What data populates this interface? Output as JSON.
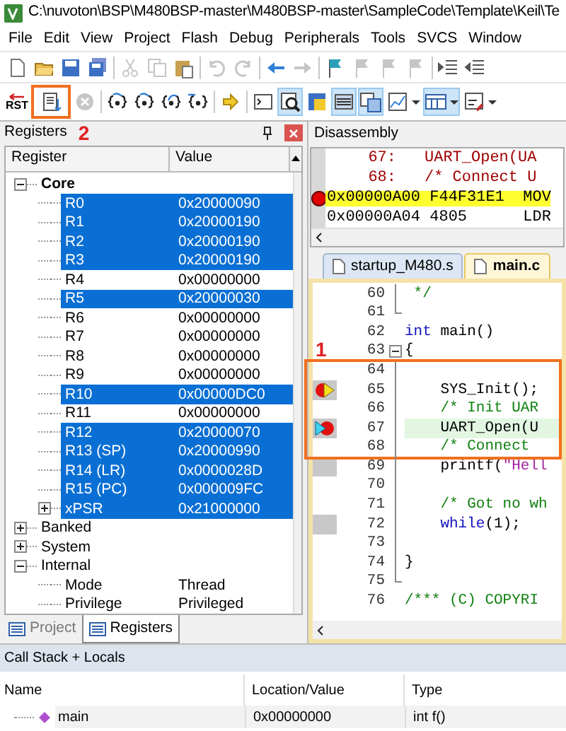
{
  "window": {
    "title": "C:\\nuvoton\\BSP\\M480BSP-master\\M480BSP-master\\SampleCode\\Template\\Keil\\Te"
  },
  "menu": [
    "File",
    "Edit",
    "View",
    "Project",
    "Flash",
    "Debug",
    "Peripherals",
    "Tools",
    "SVCS",
    "Window"
  ],
  "toolbar_1": [
    {
      "kind": "new",
      "disabled": false
    },
    {
      "kind": "open",
      "disabled": false
    },
    {
      "kind": "save",
      "disabled": false
    },
    {
      "kind": "save-all",
      "disabled": false
    },
    {
      "kind": "sep"
    },
    {
      "kind": "cut",
      "disabled": true
    },
    {
      "kind": "copy",
      "disabled": true
    },
    {
      "kind": "paste",
      "disabled": false
    },
    {
      "kind": "sep"
    },
    {
      "kind": "undo",
      "disabled": true
    },
    {
      "kind": "redo",
      "disabled": true
    },
    {
      "kind": "sep"
    },
    {
      "kind": "back",
      "disabled": false
    },
    {
      "kind": "forward",
      "disabled": true
    },
    {
      "kind": "sep"
    },
    {
      "kind": "bookmark",
      "disabled": false
    },
    {
      "kind": "bookmark",
      "disabled": true
    },
    {
      "kind": "bookmark",
      "disabled": true
    },
    {
      "kind": "bookmark",
      "disabled": true
    },
    {
      "kind": "sep"
    },
    {
      "kind": "indent",
      "disabled": false
    },
    {
      "kind": "unindent",
      "disabled": false
    }
  ],
  "toolbar_2": [
    {
      "kind": "reset",
      "label": "RST",
      "disabled": false,
      "pressed": false,
      "highlighted": false
    },
    {
      "kind": "run",
      "disabled": false,
      "pressed": false,
      "highlighted": true
    },
    {
      "kind": "stop",
      "disabled": true,
      "pressed": false,
      "highlighted": false
    },
    {
      "kind": "sep"
    },
    {
      "kind": "step-in",
      "disabled": false,
      "pressed": false,
      "highlighted": false
    },
    {
      "kind": "step-over",
      "disabled": false,
      "pressed": false,
      "highlighted": false
    },
    {
      "kind": "step-out",
      "disabled": false,
      "pressed": false,
      "highlighted": false
    },
    {
      "kind": "run-to-cursor",
      "disabled": false,
      "pressed": false,
      "highlighted": false
    },
    {
      "kind": "sep"
    },
    {
      "kind": "show-next",
      "disabled": false,
      "pressed": false,
      "highlighted": false
    },
    {
      "kind": "sep"
    },
    {
      "kind": "command",
      "disabled": false,
      "pressed": false,
      "highlighted": false
    },
    {
      "kind": "disassembly",
      "disabled": false,
      "pressed": true,
      "highlighted": false
    },
    {
      "kind": "symbols",
      "disabled": false,
      "pressed": false,
      "highlighted": false
    },
    {
      "kind": "registers",
      "disabled": false,
      "pressed": true,
      "highlighted": false
    },
    {
      "kind": "call-stack",
      "disabled": false,
      "pressed": true,
      "highlighted": false
    },
    {
      "kind": "watch",
      "disabled": false,
      "pressed": false,
      "highlighted": false,
      "dropdown": true
    },
    {
      "kind": "memory",
      "disabled": false,
      "pressed": true,
      "highlighted": false,
      "dropdown": true
    },
    {
      "kind": "serial",
      "disabled": false,
      "pressed": false,
      "highlighted": false,
      "dropdown": true
    }
  ],
  "registers_panel": {
    "title": "Registers",
    "callout": "2",
    "columns": [
      "Register",
      "Value"
    ],
    "rows": [
      {
        "name": "Core",
        "bold": true,
        "expanded": true,
        "selected": false,
        "children": [
          {
            "name": "R0",
            "value": "0x20000090",
            "selected": true
          },
          {
            "name": "R1",
            "value": "0x20000190",
            "selected": true
          },
          {
            "name": "R2",
            "value": "0x20000190",
            "selected": true
          },
          {
            "name": "R3",
            "value": "0x20000190",
            "selected": true
          },
          {
            "name": "R4",
            "value": "0x00000000",
            "selected": false
          },
          {
            "name": "R5",
            "value": "0x20000030",
            "selected": true
          },
          {
            "name": "R6",
            "value": "0x00000000",
            "selected": false
          },
          {
            "name": "R7",
            "value": "0x00000000",
            "selected": false
          },
          {
            "name": "R8",
            "value": "0x00000000",
            "selected": false
          },
          {
            "name": "R9",
            "value": "0x00000000",
            "selected": false
          },
          {
            "name": "R10",
            "value": "0x00000DC0",
            "selected": true
          },
          {
            "name": "R11",
            "value": "0x00000000",
            "selected": false
          },
          {
            "name": "R12",
            "value": "0x20000070",
            "selected": true
          },
          {
            "name": "R13 (SP)",
            "value": "0x20000990",
            "selected": true
          },
          {
            "name": "R14 (LR)",
            "value": "0x0000028D",
            "selected": true
          },
          {
            "name": "R15 (PC)",
            "value": "0x000009FC",
            "selected": true
          },
          {
            "name": "xPSR",
            "value": "0x21000000",
            "selected": true,
            "expanded": false
          }
        ]
      },
      {
        "name": "Banked",
        "expanded": false,
        "selected": false
      },
      {
        "name": "System",
        "expanded": false,
        "selected": false
      },
      {
        "name": "Internal",
        "expanded": true,
        "selected": false,
        "children": [
          {
            "name": "Mode",
            "value": "Thread",
            "selected": false
          },
          {
            "name": "Privilege",
            "value": "Privileged",
            "selected": false
          }
        ]
      }
    ]
  },
  "left_tabs": [
    {
      "label": "Project",
      "selected": false
    },
    {
      "label": "Registers",
      "selected": true
    }
  ],
  "disassembly": {
    "title": "Disassembly",
    "lines": [
      {
        "kind": "source",
        "number": "67:",
        "text": "UART_Open(UA"
      },
      {
        "kind": "source",
        "number": "68:",
        "text": "/* Connect U"
      },
      {
        "kind": "asm",
        "address": "0x00000A00",
        "opcode": "F44F31E1",
        "mnemonic": "MOV",
        "current": true,
        "breakpoint": true
      },
      {
        "kind": "asm",
        "address": "0x00000A04",
        "opcode": "4805",
        "mnemonic": "LDR",
        "current": false,
        "breakpoint": false
      }
    ]
  },
  "file_tabs": [
    {
      "label": "startup_M480.s",
      "selected": false
    },
    {
      "label": "main.c",
      "selected": true
    }
  ],
  "editor": {
    "callout": "1",
    "lines": [
      {
        "number": "60",
        "fold": {
          "kind": "line"
        },
        "executable": false,
        "highlighted": false,
        "boxed": false,
        "tokens": [
          {
            "kind": "comment",
            "text": " */"
          }
        ]
      },
      {
        "number": "61",
        "fold": {
          "kind": "end"
        },
        "executable": false,
        "highlighted": false,
        "boxed": false
      },
      {
        "number": "62",
        "executable": false,
        "highlighted": false,
        "boxed": false,
        "tokens": [
          {
            "kind": "keyword",
            "text": "int"
          },
          {
            "kind": "plain",
            "text": " main()"
          }
        ]
      },
      {
        "number": "63",
        "fold": {
          "kind": "box"
        },
        "executable": false,
        "highlighted": false,
        "boxed": false,
        "tokens": [
          {
            "kind": "plain",
            "text": "{"
          }
        ]
      },
      {
        "number": "64",
        "fold": {
          "kind": "line"
        },
        "executable": false,
        "highlighted": false,
        "boxed": true
      },
      {
        "number": "65",
        "fold": {
          "kind": "line"
        },
        "marker": {
          "kind": "current"
        },
        "executable": true,
        "highlighted": false,
        "boxed": true,
        "tokens": [
          {
            "kind": "plain",
            "text": "    SYS_Init();"
          }
        ]
      },
      {
        "number": "66",
        "fold": {
          "kind": "line"
        },
        "executable": false,
        "highlighted": false,
        "boxed": true,
        "tokens": [
          {
            "kind": "comment",
            "text": "    /* Init UAR"
          }
        ]
      },
      {
        "number": "67",
        "fold": {
          "kind": "line"
        },
        "marker": {
          "kind": "caller"
        },
        "executable": true,
        "highlighted": true,
        "boxed": true,
        "tokens": [
          {
            "kind": "plain",
            "text": "    UART_Open(U"
          }
        ]
      },
      {
        "number": "68",
        "fold": {
          "kind": "line"
        },
        "executable": false,
        "highlighted": false,
        "boxed": true,
        "tokens": [
          {
            "kind": "comment",
            "text": "    /* Connect"
          }
        ]
      },
      {
        "number": "69",
        "fold": {
          "kind": "line"
        },
        "executable": true,
        "highlighted": false,
        "boxed": false,
        "tokens": [
          {
            "kind": "plain",
            "text": "    printf("
          },
          {
            "kind": "string",
            "text": "\"Hell"
          }
        ]
      },
      {
        "number": "70",
        "fold": {
          "kind": "line"
        },
        "executable": false,
        "highlighted": false,
        "boxed": false
      },
      {
        "number": "71",
        "fold": {
          "kind": "line"
        },
        "executable": false,
        "highlighted": false,
        "boxed": false,
        "tokens": [
          {
            "kind": "comment",
            "text": "    /* Got no wh"
          }
        ]
      },
      {
        "number": "72",
        "fold": {
          "kind": "line"
        },
        "executable": true,
        "highlighted": false,
        "boxed": false,
        "tokens": [
          {
            "kind": "keyword",
            "text": "    while"
          },
          {
            "kind": "plain",
            "text": "(1);"
          }
        ]
      },
      {
        "number": "73",
        "fold": {
          "kind": "line"
        },
        "executable": false,
        "highlighted": false,
        "boxed": false
      },
      {
        "number": "74",
        "fold": {
          "kind": "line"
        },
        "executable": false,
        "highlighted": false,
        "boxed": false,
        "tokens": [
          {
            "kind": "plain",
            "text": "}"
          }
        ]
      },
      {
        "number": "75",
        "fold": {
          "kind": "end"
        },
        "executable": false,
        "highlighted": false,
        "boxed": false
      },
      {
        "number": "76",
        "executable": false,
        "highlighted": false,
        "boxed": false,
        "tokens": [
          {
            "kind": "comment",
            "text": "/*** (C) COPYRI"
          }
        ]
      }
    ]
  },
  "call_stack": {
    "title": "Call Stack + Locals",
    "columns": [
      "Name",
      "Location/Value",
      "Type"
    ],
    "rows": [
      {
        "name": "main",
        "value": "0x00000000",
        "type": "int f()"
      }
    ]
  }
}
